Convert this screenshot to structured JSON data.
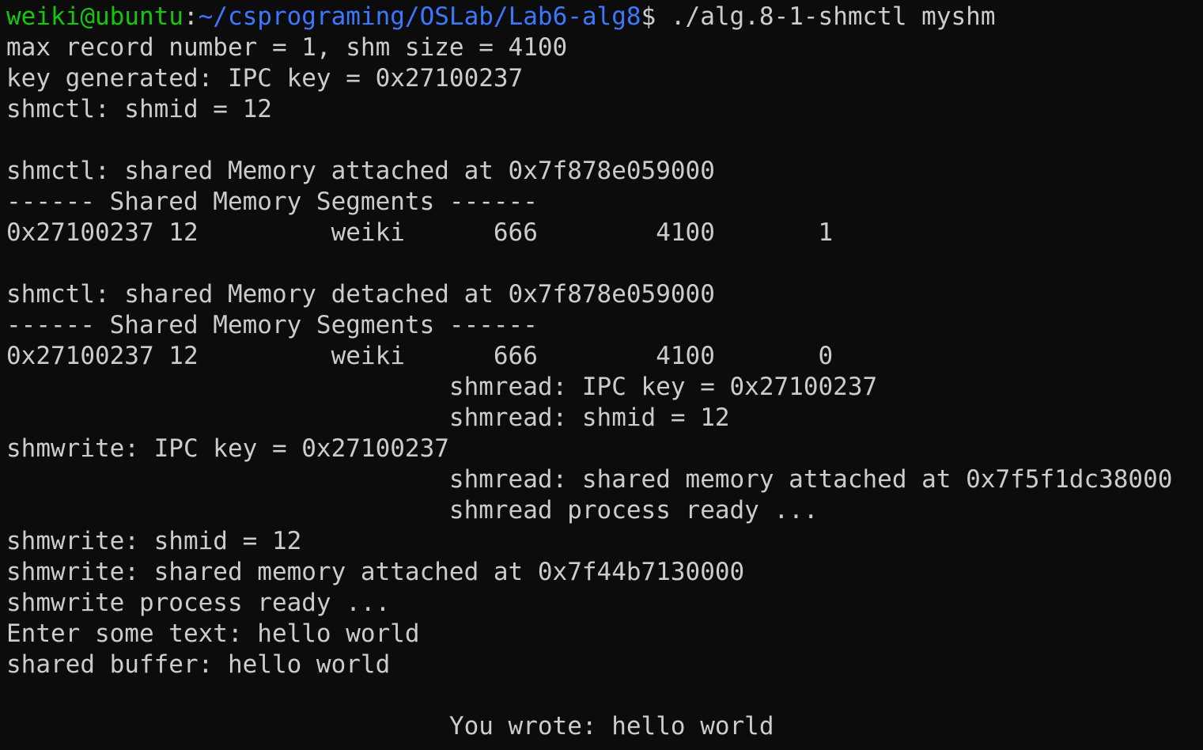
{
  "colors": {
    "background": "#0c0c0c",
    "text": "#cccccc",
    "prompt_user_host": "#16c60c",
    "prompt_path": "#3b78ff"
  },
  "prompt": {
    "user_host": "weiki@ubuntu",
    "separator": ":",
    "path": "~/csprograming/OSLab/Lab6-alg8",
    "symbol": "$ ",
    "command": "./alg.8-1-shmctl myshm"
  },
  "output_lines": [
    "max record number = 1, shm size = 4100",
    "key generated: IPC key = 0x27100237",
    "shmctl: shmid = 12",
    "",
    "shmctl: shared Memory attached at 0x7f878e059000",
    "------ Shared Memory Segments ------",
    "0x27100237 12         weiki      666        4100       1",
    "",
    "shmctl: shared Memory detached at 0x7f878e059000",
    "------ Shared Memory Segments ------",
    "0x27100237 12         weiki      666        4100       0",
    "                              shmread: IPC key = 0x27100237",
    "                              shmread: shmid = 12",
    "shmwrite: IPC key = 0x27100237",
    "                              shmread: shared memory attached at 0x7f5f1dc38000",
    "                              shmread process ready ...",
    "shmwrite: shmid = 12",
    "shmwrite: shared memory attached at 0x7f44b7130000",
    "shmwrite process ready ...",
    "Enter some text: hello world",
    "shared buffer: hello world",
    "",
    "                              You wrote: hello world"
  ]
}
